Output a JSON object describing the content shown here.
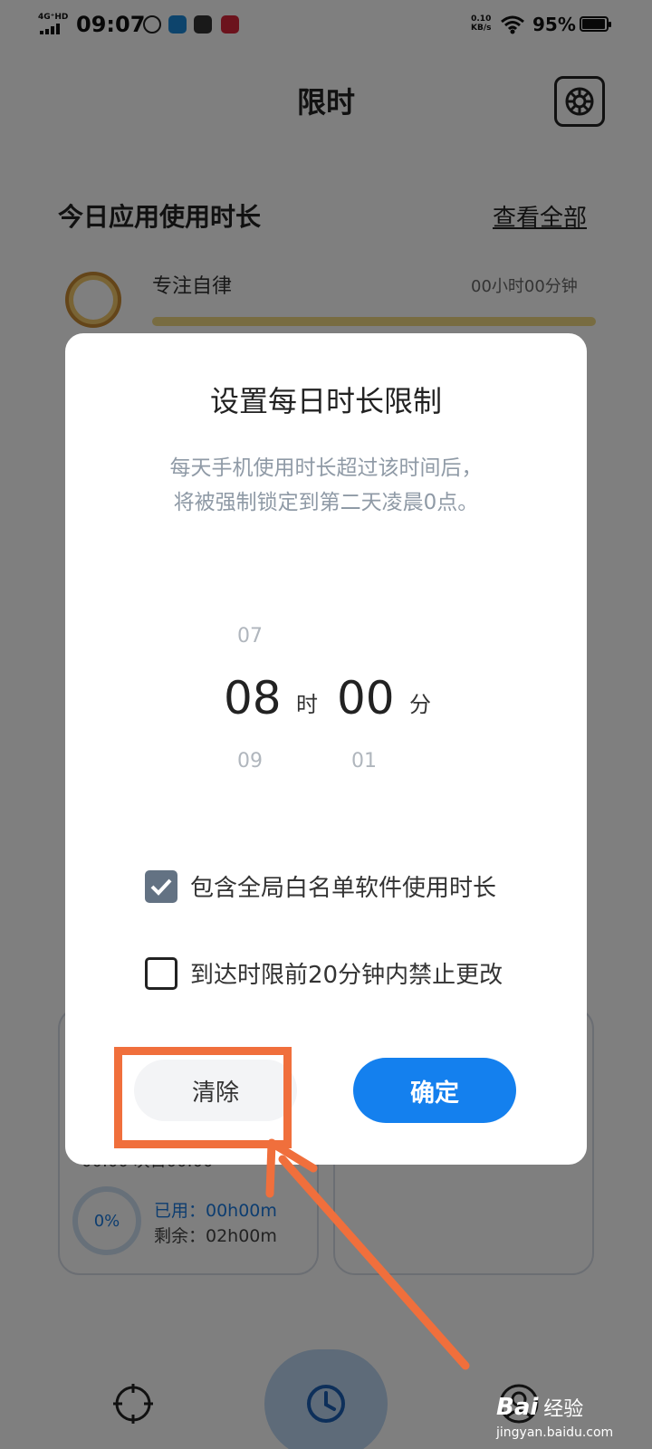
{
  "status_bar": {
    "network": "4G⁺HD",
    "time": "09:07",
    "net_speed_value": "0.10",
    "net_speed_unit": "KB/s",
    "battery": "95%"
  },
  "header": {
    "title": "限时"
  },
  "usage_section": {
    "title": "今日应用使用时长",
    "view_all": "查看全部",
    "app": {
      "name": "专注自律",
      "time": "00小时00分钟"
    }
  },
  "card_left": {
    "partial_text": "00:00 次日00:00",
    "percent": "0%",
    "used": "已用：00h00m",
    "remaining": "剩余：02h00m"
  },
  "dialog": {
    "title": "设置每日时长限制",
    "desc_line1": "每天手机使用时长超过该时间后，",
    "desc_line2": "将被强制锁定到第二天凌晨0点。",
    "picker": {
      "hour_prev": "07",
      "hour": "08",
      "hour_next": "09",
      "hour_unit": "时",
      "minute": "00",
      "minute_next": "01",
      "minute_unit": "分"
    },
    "option_whitelist": {
      "label": "包含全局白名单软件使用时长",
      "checked": true
    },
    "option_lock": {
      "label": "到达时限前20分钟内禁止更改",
      "checked": false
    },
    "clear_label": "清除",
    "confirm_label": "确定"
  },
  "watermark": {
    "logo": "Bai",
    "text": "经验",
    "url": "jingyan.baidu.com"
  },
  "colors": {
    "accent": "#1480ee",
    "annotation": "#f06f3c",
    "checkbox_on": "#637283"
  }
}
